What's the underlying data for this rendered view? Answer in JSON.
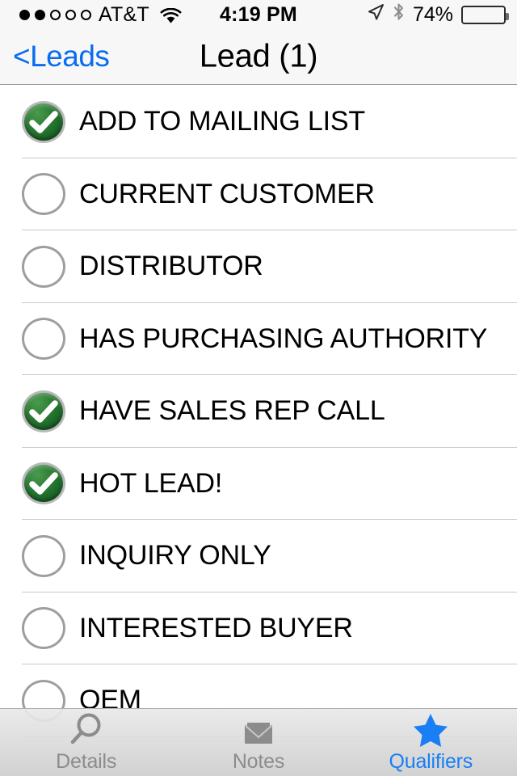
{
  "status_bar": {
    "signal_dots_total": 5,
    "signal_dots_filled": 2,
    "carrier": "AT&T",
    "wifi_icon": "wifi-icon",
    "time": "4:19 PM",
    "location_icon": "location-arrow-icon",
    "bluetooth_icon": "bluetooth-icon",
    "battery_percent_label": "74%",
    "battery_level": 74,
    "battery_icon": "battery-icon"
  },
  "nav_bar": {
    "back_label": "<Leads",
    "title": "Lead (1)",
    "back_color": "#0a6cf0",
    "background": "#f7f7f7"
  },
  "list": {
    "checked_color": "#2f7f37",
    "items": [
      {
        "label": "ADD TO MAILING LIST",
        "checked": true
      },
      {
        "label": "CURRENT CUSTOMER",
        "checked": false
      },
      {
        "label": "DISTRIBUTOR",
        "checked": false
      },
      {
        "label": "HAS PURCHASING AUTHORITY",
        "checked": false
      },
      {
        "label": "HAVE SALES REP CALL",
        "checked": true
      },
      {
        "label": "HOT LEAD!",
        "checked": true
      },
      {
        "label": "INQUIRY ONLY",
        "checked": false
      },
      {
        "label": "INTERESTED BUYER",
        "checked": false
      },
      {
        "label": "OEM",
        "checked": false
      }
    ]
  },
  "tab_bar": {
    "active_color": "#1a7ef5",
    "inactive_color": "#8c8c8c",
    "tabs": [
      {
        "label": "Details",
        "icon": "magnifier-icon",
        "active": false
      },
      {
        "label": "Notes",
        "icon": "envelope-icon",
        "active": false
      },
      {
        "label": "Qualifiers",
        "icon": "star-icon",
        "active": true
      }
    ]
  }
}
